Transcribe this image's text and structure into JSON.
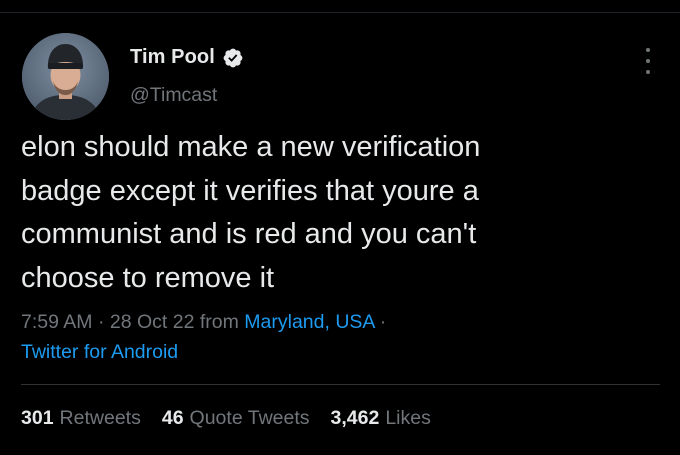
{
  "tweet": {
    "author_name": "Tim Pool",
    "handle": "@Timcast",
    "verified": true,
    "text": "elon should make a new verification\nbadge except it verifies that youre a\ncommunist and is red and you can't\nchoose to remove it",
    "time": "7:59 AM",
    "sep1": "·",
    "date": "28 Oct 22",
    "from_word": "from",
    "location": "Maryland, USA",
    "sep2": "·",
    "client": "Twitter for Android"
  },
  "stats": [
    {
      "count": "301",
      "label": "Retweets"
    },
    {
      "count": "46",
      "label": "Quote Tweets"
    },
    {
      "count": "3,462",
      "label": "Likes"
    }
  ],
  "icons": {
    "verified": "verified-badge-icon",
    "more": "more-options-icon"
  },
  "colors": {
    "background": "#000000",
    "text": "#e7e9ea",
    "secondary": "#71767b",
    "link": "#1d9bf0"
  }
}
